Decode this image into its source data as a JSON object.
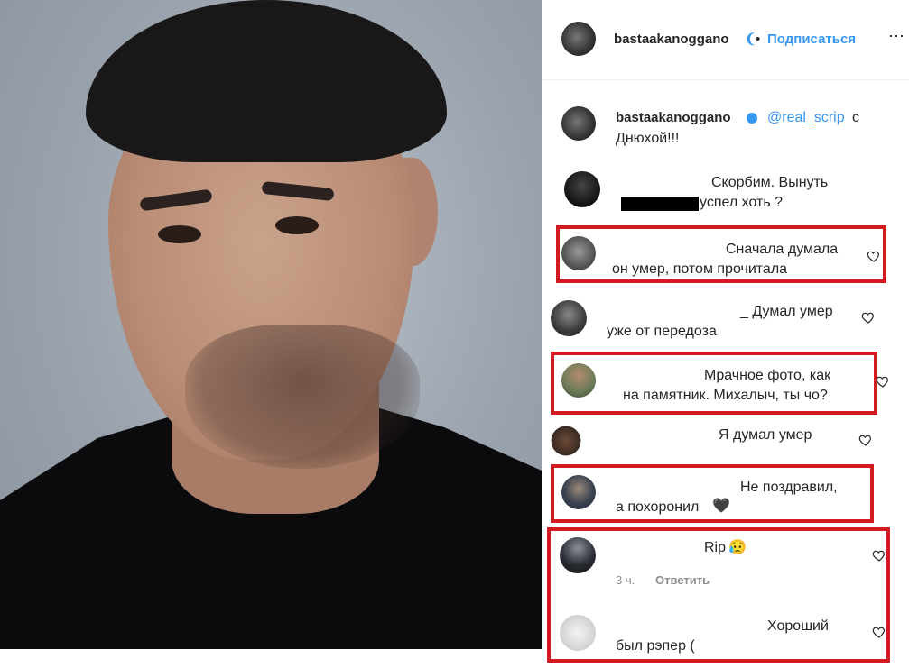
{
  "header": {
    "username": "bastaakanoggano",
    "dot": "•",
    "follow_label": "Подписаться"
  },
  "caption": {
    "username": "bastaakanoggano",
    "mention": "@real_scrip",
    "text_1": "с",
    "text_2": "Днюхой!!!"
  },
  "comments": [
    {
      "line1": "Скорбим. Вынуть",
      "line2": "успел хоть ?"
    },
    {
      "line1": "Сначала думала",
      "line2": "он умер, потом прочитала"
    },
    {
      "line1": "_ Думал умер",
      "line2": "уже от передоза"
    },
    {
      "line1": "Мрачное фото, как",
      "line2": "на памятник. Михалыч, ты чо?"
    },
    {
      "line1": "Я думал умер"
    },
    {
      "line1": "Не поздравил,",
      "line2": "а похоронил",
      "emoji": "🖤"
    },
    {
      "line1": "Rip",
      "emoji": "😥",
      "time": "3 ч.",
      "reply_label": "Ответить"
    },
    {
      "line1": "Хороший",
      "line2": "был рэпер ("
    }
  ],
  "colors": {
    "highlight": "#d11a22",
    "link": "#3897f0"
  },
  "icons": [
    "heart-icon",
    "verified-badge-icon",
    "avatar"
  ]
}
